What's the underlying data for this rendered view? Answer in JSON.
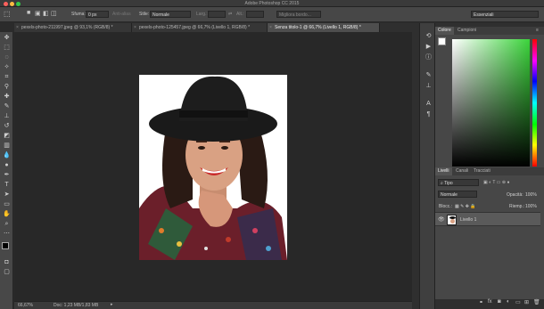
{
  "window": {
    "title": "Adobe Photoshop CC 2015"
  },
  "options_bar": {
    "feather_label": "Sfuma:",
    "feather_value": "0 px",
    "antialias_label": "Anti-alias",
    "style_label": "Stile:",
    "style_value": "Normale",
    "width_label": "Larg.:",
    "height_label": "Alt.:",
    "refine_label": "Migliora bordo...",
    "workspace": "Essenziali"
  },
  "tabs": [
    {
      "label": "pexels-photo-211997.jpeg @ 93,1% (RGB/8) *",
      "active": false
    },
    {
      "label": "pexels-photo-125457.jpeg @ 66,7% (Livello 1, RGB/8) *",
      "active": false
    },
    {
      "label": "Senza titolo-1 @ 66,7% (Livello 1, RGB/8) *",
      "active": true
    }
  ],
  "status": {
    "zoom": "66,67%",
    "doc": "Doc: 1,23 MB/1,83 MB"
  },
  "color_panel": {
    "tabs": [
      "Colore",
      "Campioni"
    ]
  },
  "layers_panel": {
    "tabs": [
      "Livelli",
      "Canali",
      "Tracciati"
    ],
    "filter": "Tipo",
    "blend": "Normale",
    "opacity_label": "Opacità:",
    "opacity_value": "100%",
    "lock_label": "Blocc.:",
    "fill_label": "Riemp.:",
    "fill_value": "100%",
    "layers": [
      {
        "name": "Livello 1",
        "visible": true
      }
    ]
  },
  "colors": {
    "traffic_close": "#fc605c",
    "traffic_min": "#fdbc40",
    "traffic_max": "#34c84a",
    "hat": "#1a1a1a",
    "skin": "#d9a183",
    "hair": "#2a1a14",
    "lips": "#c8282a"
  }
}
